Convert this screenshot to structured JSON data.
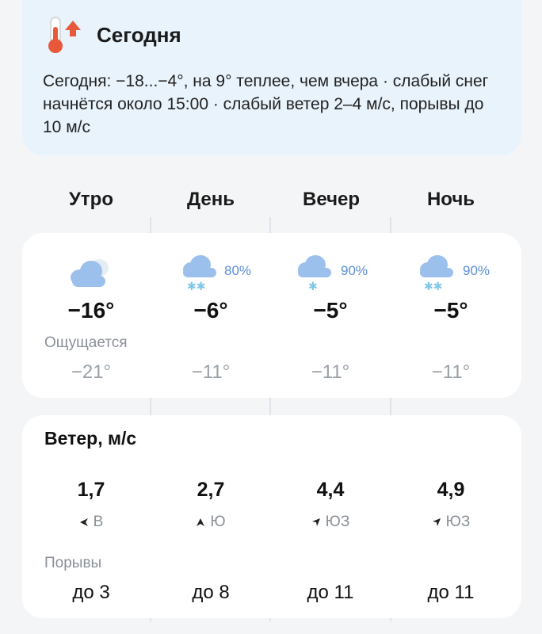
{
  "summary": {
    "title": "Сегодня",
    "text": "Сегодня: −18...−4°, на 9° теплее, чем вчера · слабый снег начнётся около 15:00 · слабый ветер 2–4 м/с, порывы до 10 м/с",
    "icon": "thermometer-up-icon",
    "accent_color": "#e8593c"
  },
  "periods": [
    {
      "name": "Утро",
      "icon": "partly-cloudy-icon",
      "precip_prob": "",
      "temp": "−16°",
      "feels": "−21°",
      "wind_speed": "1,7",
      "wind_dir": "В",
      "gust": "до 3"
    },
    {
      "name": "День",
      "icon": "cloud-snow-icon",
      "precip_prob": "80%",
      "temp": "−6°",
      "feels": "−11°",
      "wind_speed": "2,7",
      "wind_dir": "Ю",
      "gust": "до 8"
    },
    {
      "name": "Вечер",
      "icon": "cloud-light-snow-icon",
      "precip_prob": "90%",
      "temp": "−5°",
      "feels": "−11°",
      "wind_speed": "4,4",
      "wind_dir": "ЮЗ",
      "gust": "до 11"
    },
    {
      "name": "Ночь",
      "icon": "cloud-snow-icon",
      "precip_prob": "90%",
      "temp": "−5°",
      "feels": "−11°",
      "wind_speed": "4,9",
      "wind_dir": "ЮЗ",
      "gust": "до 11"
    }
  ],
  "labels": {
    "feels": "Ощущается",
    "wind": "Ветер, м/с",
    "gusts": "Порывы"
  },
  "colors": {
    "cloud": "#9cc0ec",
    "snow": "#7fc6e8",
    "precip_text": "#5b8ed6"
  }
}
